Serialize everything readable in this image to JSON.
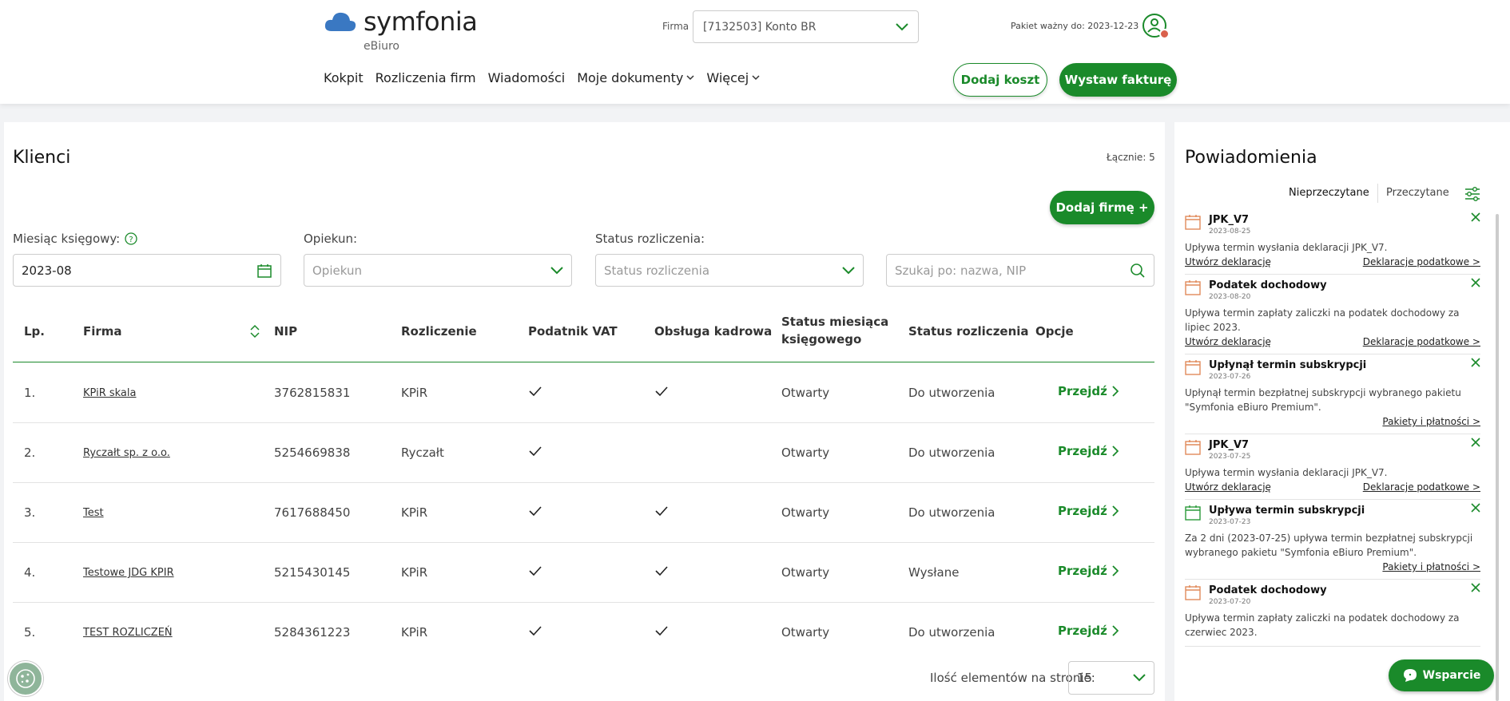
{
  "header": {
    "logo_text": "symfonia",
    "logo_sub": "eBiuro",
    "firma_label": "Firma",
    "firma_value": "[7132503] Konto BR",
    "pakiet": "Pakiet ważny do: 2023-12-23",
    "nav": [
      "Kokpit",
      "Rozliczenia firm",
      "Wiadomości",
      "Moje dokumenty",
      "Więcej"
    ],
    "btn_koszt": "Dodaj koszt",
    "btn_faktura": "Wystaw fakturę"
  },
  "clients": {
    "title": "Klienci",
    "total": "Łącznie: 5",
    "add_button": "Dodaj firmę +",
    "filters": {
      "month_label": "Miesiąc księgowy:",
      "month_value": "2023-08",
      "opiekun_label": "Opiekun:",
      "opiekun_placeholder": "Opiekun",
      "status_label": "Status rozliczenia:",
      "status_placeholder": "Status rozliczenia",
      "search_placeholder": "Szukaj po: nazwa, NIP"
    },
    "columns": [
      "Lp.",
      "Firma",
      "NIP",
      "Rozliczenie",
      "Podatnik VAT",
      "Obsługa kadrowa",
      "Status miesiąca księgowego",
      "Status rozliczenia",
      "Opcje"
    ],
    "rows": [
      {
        "lp": "1.",
        "firma": "KPiR skala",
        "nip": "3762815831",
        "rozliczenie": "KPiR",
        "vat": true,
        "kadry": true,
        "status_mies": "Otwarty",
        "status_rozl": "Do utworzenia",
        "opcja": "Przejdź"
      },
      {
        "lp": "2.",
        "firma": "Ryczałt sp. z o.o.",
        "nip": "5254669838",
        "rozliczenie": "Ryczałt",
        "vat": true,
        "kadry": false,
        "status_mies": "Otwarty",
        "status_rozl": "Do utworzenia",
        "opcja": "Przejdź"
      },
      {
        "lp": "3.",
        "firma": "Test",
        "nip": "7617688450",
        "rozliczenie": "KPiR",
        "vat": true,
        "kadry": true,
        "status_mies": "Otwarty",
        "status_rozl": "Do utworzenia",
        "opcja": "Przejdź"
      },
      {
        "lp": "4.",
        "firma": "Testowe JDG KPIR",
        "nip": "5215430145",
        "rozliczenie": "KPiR",
        "vat": true,
        "kadry": true,
        "status_mies": "Otwarty",
        "status_rozl": "Wysłane",
        "opcja": "Przejdź"
      },
      {
        "lp": "5.",
        "firma": "TEST ROZLICZEŃ",
        "nip": "5284361223",
        "rozliczenie": "KPiR",
        "vat": true,
        "kadry": true,
        "status_mies": "Otwarty",
        "status_rozl": "Do utworzenia",
        "opcja": "Przejdź"
      }
    ],
    "per_page_label": "Ilość elementów na stronie:",
    "per_page_value": "15"
  },
  "notifications": {
    "title": "Powiadomienia",
    "tab_unread": "Nieprzeczytane",
    "tab_read": "Przeczytane",
    "items": [
      {
        "title": "JPK_V7",
        "date": "2023-08-25",
        "body": "Upływa termin wysłania deklaracji JPK_V7.",
        "link_left": "Utwórz deklarację",
        "link_right": "Deklaracje podatkowe >",
        "icon_color": "#e08a5a"
      },
      {
        "title": "Podatek dochodowy",
        "date": "2023-08-20",
        "body": "Upływa termin zapłaty zaliczki na podatek dochodowy za lipiec 2023.",
        "link_left": "Utwórz deklarację",
        "link_right": "Deklaracje podatkowe >",
        "icon_color": "#e08a5a"
      },
      {
        "title": "Upłynął termin subskrypcji",
        "date": "2023-07-26",
        "body": "Upłynął termin bezpłatnej subskrypcji wybranego pakietu \"Symfonia eBiuro Premium\".",
        "link_left": "",
        "link_right": "Pakiety i płatności >",
        "icon_color": "#e08a5a"
      },
      {
        "title": "JPK_V7",
        "date": "2023-07-25",
        "body": "Upływa termin wysłania deklaracji JPK_V7.",
        "link_left": "Utwórz deklarację",
        "link_right": "Deklaracje podatkowe >",
        "icon_color": "#e08a5a"
      },
      {
        "title": "Upływa termin subskrypcji",
        "date": "2023-07-23",
        "body": "Za 2 dni (2023-07-25) upływa termin bezpłatnej subskrypcji wybranego pakietu \"Symfonia eBiuro Premium\".",
        "link_left": "",
        "link_right": "Pakiety i płatności >",
        "icon_color": "#2a9a3a"
      },
      {
        "title": "Podatek dochodowy",
        "date": "2023-07-20",
        "body": "Upływa termin zapłaty zaliczki na podatek dochodowy za czerwiec 2023.",
        "link_left": "",
        "link_right": "",
        "icon_color": "#e08a5a"
      }
    ],
    "support_button": "Wsparcie"
  }
}
